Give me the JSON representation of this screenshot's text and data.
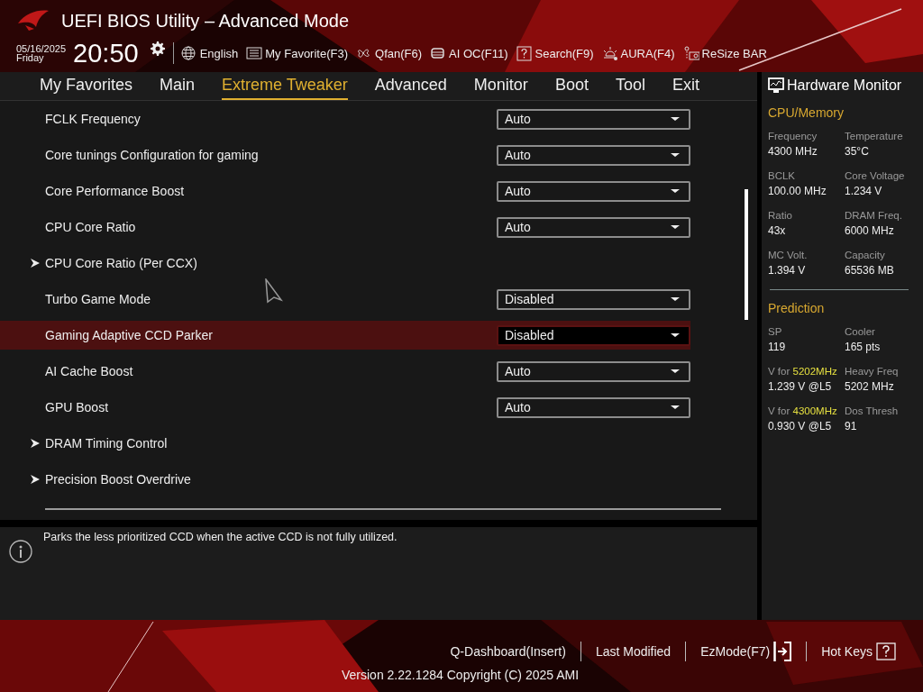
{
  "header": {
    "title": "UEFI BIOS Utility – Advanced Mode",
    "date": "05/16/2025",
    "day": "Friday",
    "time": "20:50",
    "toolbar": [
      {
        "label": "English"
      },
      {
        "label": "My Favorite(F3)"
      },
      {
        "label": "Qfan(F6)"
      },
      {
        "label": "AI OC(F11)"
      },
      {
        "label": "Search(F9)"
      },
      {
        "label": "AURA(F4)"
      },
      {
        "label": "ReSize BAR"
      }
    ]
  },
  "tabs": [
    {
      "label": "My Favorites",
      "selected": false
    },
    {
      "label": "Main",
      "selected": false
    },
    {
      "label": "Extreme Tweaker",
      "selected": true
    },
    {
      "label": "Advanced",
      "selected": false
    },
    {
      "label": "Monitor",
      "selected": false
    },
    {
      "label": "Boot",
      "selected": false
    },
    {
      "label": "Tool",
      "selected": false
    },
    {
      "label": "Exit",
      "selected": false
    }
  ],
  "settings": [
    {
      "kind": "dropdown",
      "label": "FCLK Frequency",
      "value": "Auto",
      "selected": false
    },
    {
      "kind": "dropdown",
      "label": "Core tunings Configuration for gaming",
      "value": "Auto",
      "selected": false
    },
    {
      "kind": "dropdown",
      "label": "Core Performance Boost",
      "value": "Auto",
      "selected": false
    },
    {
      "kind": "dropdown",
      "label": "CPU Core Ratio",
      "value": "Auto",
      "selected": false
    },
    {
      "kind": "submenu",
      "label": "CPU Core Ratio (Per CCX)",
      "selected": false
    },
    {
      "kind": "dropdown",
      "label": "Turbo Game Mode",
      "value": "Disabled",
      "selected": false
    },
    {
      "kind": "dropdown",
      "label": "Gaming Adaptive CCD Parker",
      "value": "Disabled",
      "selected": true
    },
    {
      "kind": "dropdown",
      "label": "AI Cache Boost",
      "value": "Auto",
      "selected": false
    },
    {
      "kind": "dropdown",
      "label": "GPU Boost",
      "value": "Auto",
      "selected": false
    },
    {
      "kind": "submenu",
      "label": "DRAM Timing Control",
      "selected": false
    },
    {
      "kind": "submenu",
      "label": "Precision Boost Overdrive",
      "selected": false
    }
  ],
  "help": {
    "text": "Parks the less prioritized CCD when the active CCD is not fully utilized."
  },
  "hardware_monitor": {
    "title": "Hardware Monitor",
    "sections": [
      {
        "title": "CPU/Memory",
        "items": [
          {
            "label": "Frequency",
            "value": "4300 MHz"
          },
          {
            "label": "Temperature",
            "value": "35°C"
          },
          {
            "label": "BCLK",
            "value": "100.00 MHz"
          },
          {
            "label": "Core Voltage",
            "value": "1.234 V"
          },
          {
            "label": "Ratio",
            "value": "43x"
          },
          {
            "label": "DRAM Freq.",
            "value": "6000 MHz"
          },
          {
            "label": "MC Volt.",
            "value": "1.394 V"
          },
          {
            "label": "Capacity",
            "value": "65536 MB"
          }
        ]
      },
      {
        "title": "Prediction",
        "items": [
          {
            "label": "SP",
            "value": "119"
          },
          {
            "label": "Cooler",
            "value": "165 pts"
          },
          {
            "label": "V for",
            "highlight": "5202MHz",
            "value": "1.239 V @L5"
          },
          {
            "label": "Heavy Freq",
            "value": "5202 MHz"
          },
          {
            "label": "V for",
            "highlight": "4300MHz",
            "value": "0.930 V @L5"
          },
          {
            "label": "Dos Thresh",
            "value": "91"
          }
        ]
      }
    ]
  },
  "footer": {
    "buttons": [
      {
        "label": "Q-Dashboard(Insert)"
      },
      {
        "label": "Last Modified"
      },
      {
        "label": "EzMode(F7)"
      },
      {
        "label": "Hot Keys"
      }
    ],
    "version": "Version 2.22.1284 Copyright (C) 2025 AMI"
  }
}
